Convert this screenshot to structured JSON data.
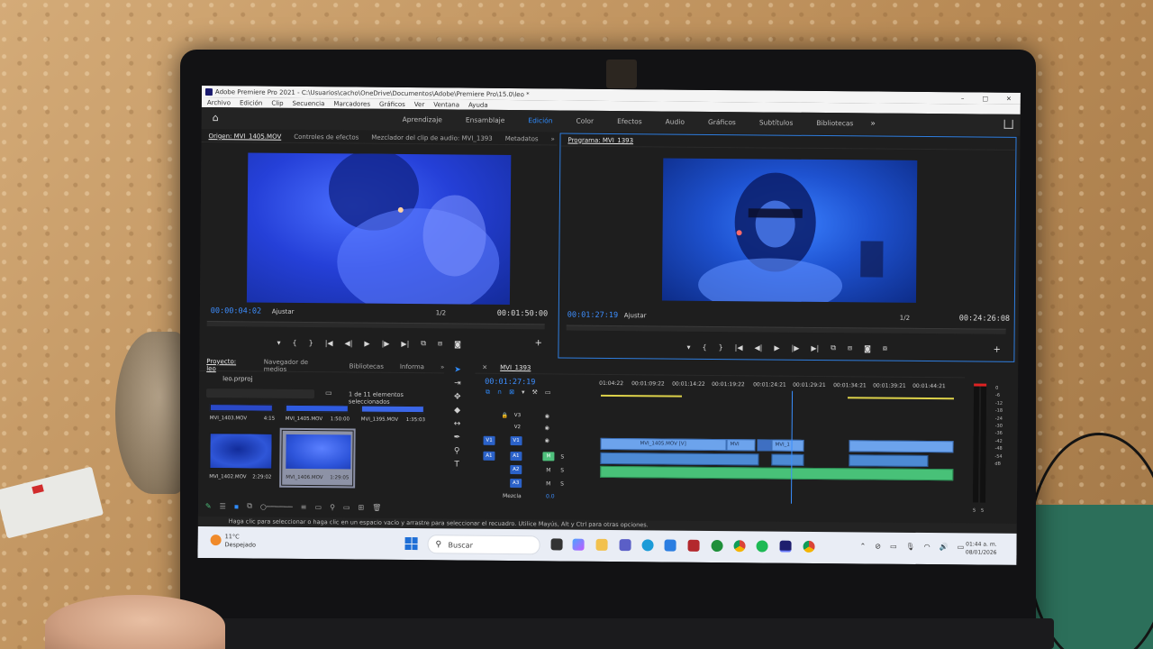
{
  "window": {
    "title": "Adobe Premiere Pro 2021 - C:\\Usuarios\\cacho\\OneDrive\\Documentos\\Adobe\\Premiere Pro\\15.0\\leo *",
    "controls": [
      "–",
      "□",
      "✕"
    ]
  },
  "menu": [
    "Archivo",
    "Edición",
    "Clip",
    "Secuencia",
    "Marcadores",
    "Gráficos",
    "Ver",
    "Ventana",
    "Ayuda"
  ],
  "workspaces": {
    "tabs": [
      "Aprendizaje",
      "Ensamblaje",
      "Edición",
      "Color",
      "Efectos",
      "Audio",
      "Gráficos",
      "Subtítulos",
      "Bibliotecas"
    ],
    "active": "Edición",
    "more": "»"
  },
  "source": {
    "tabs": [
      "Origen: MVI_1405.MOV",
      "Controles de efectos",
      "Mezclador del clip de audio: MVI_1393",
      "Metadatos"
    ],
    "more": "»",
    "timecode": "00:00:04:02",
    "fit": "Ajustar",
    "resolution": "1/2",
    "duration": "00:01:50:00",
    "transport": [
      "▾",
      "{",
      "}",
      "|◀",
      "◀|",
      "▶",
      "|▶",
      "▶|",
      "⧉",
      "⧈",
      "◙"
    ],
    "add": "+"
  },
  "program": {
    "tab": "Programa: MVI_1393",
    "timecode": "00:01:27:19",
    "fit": "Ajustar",
    "resolution": "1/2",
    "duration": "00:24:26:08",
    "transport": [
      "▾",
      "{",
      "}",
      "|◀",
      "◀|",
      "▶",
      "|▶",
      "▶|",
      "⧉",
      "⧈",
      "◙",
      "⧇"
    ],
    "add": "+"
  },
  "project": {
    "tabs": [
      "Proyecto: leo",
      "Navegador de medios",
      "Bibliotecas",
      "Informa"
    ],
    "more": "»",
    "file": "leo.prproj",
    "selection_info": "1 de 11 elementos seleccionados",
    "items": [
      {
        "name": "MVI_1403.MOV",
        "duration": "4:15"
      },
      {
        "name": "MVI_1405.MOV",
        "duration": "1:50:00"
      },
      {
        "name": "MVI_1395.MOV",
        "duration": "1:35:03"
      },
      {
        "name": "MVI_1402.MOV",
        "duration": "2:29:02"
      },
      {
        "name": "MVI_1406.MOV",
        "duration": "1:29:05"
      }
    ]
  },
  "timeline": {
    "tab": "MVI_1393",
    "timecode": "00:01:27:19",
    "ruler": [
      "01:04:22",
      "00:01:09:22",
      "00:01:14:22",
      "00:01:19:22",
      "00:01:24:21",
      "00:01:29:21",
      "00:01:34:21",
      "00:01:39:21",
      "00:01:44:21"
    ],
    "video_tracks": [
      "V3",
      "V2",
      "V1"
    ],
    "audio_tracks": [
      "A1",
      "A2",
      "A3"
    ],
    "source_patch_v": "V1",
    "source_patch_a": "A1",
    "mix_label": "Mezcla",
    "mix_value": "0.0",
    "clip_label": "MVI_1405.MOV [V]",
    "clip_label2": "MVI",
    "clip_label3": "MVI_1",
    "mute": "M",
    "solo": "S"
  },
  "meters": {
    "scale": [
      "0",
      "-6",
      "-12",
      "-18",
      "-24",
      "-30",
      "-36",
      "-42",
      "-48",
      "-54",
      "dB"
    ],
    "solo": [
      "S",
      "S"
    ]
  },
  "status": "Haga clic para seleccionar o haga clic en un espacio vacío y arrastre para seleccionar el recuadro. Utilice Mayús, Alt y Ctrl para otras opciones.",
  "taskbar": {
    "temp": "11°C",
    "weather": "Despejado",
    "search": "Buscar",
    "time": "01:44 a. m.",
    "date": "08/01/2026"
  }
}
